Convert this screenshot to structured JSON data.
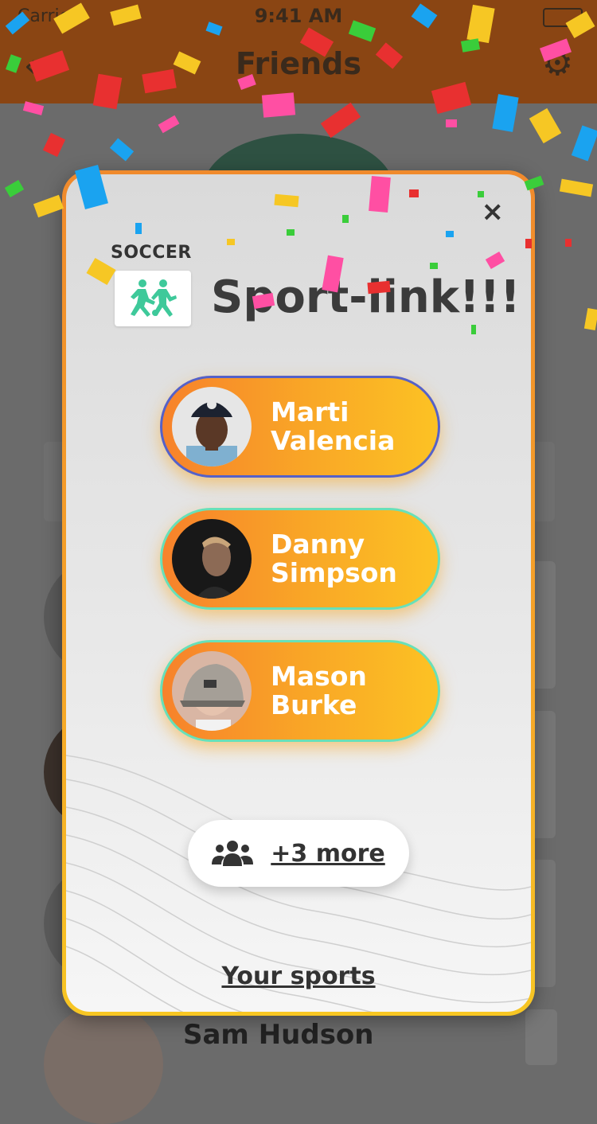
{
  "status_bar": {
    "carrier": "Carrier",
    "time": "9:41 AM"
  },
  "nav": {
    "title": "Friends",
    "back_icon": "chevron-left-icon",
    "settings_icon": "gear-icon"
  },
  "background_list": {
    "visible_row_name": "Sam Hudson"
  },
  "modal": {
    "close_label": "×",
    "sport_label": "SOCCER",
    "sport_icon": "soccer-players-icon",
    "headline": "Sport-link!!!",
    "matches": [
      {
        "first": "Marti",
        "last": "Valencia",
        "border_color": "#5561c8"
      },
      {
        "first": "Danny",
        "last": "Simpson",
        "border_color": "#68e0b8"
      },
      {
        "first": "Mason",
        "last": "Burke",
        "border_color": "#68e0b8"
      }
    ],
    "more_label": "+3 more",
    "more_icon": "group-icon",
    "footer_link": "Your sports"
  },
  "colors": {
    "accent_orange": "#f7822b",
    "accent_yellow": "#fcc224",
    "sport_green": "#3ec99a",
    "dim_header": "#8a4513"
  }
}
